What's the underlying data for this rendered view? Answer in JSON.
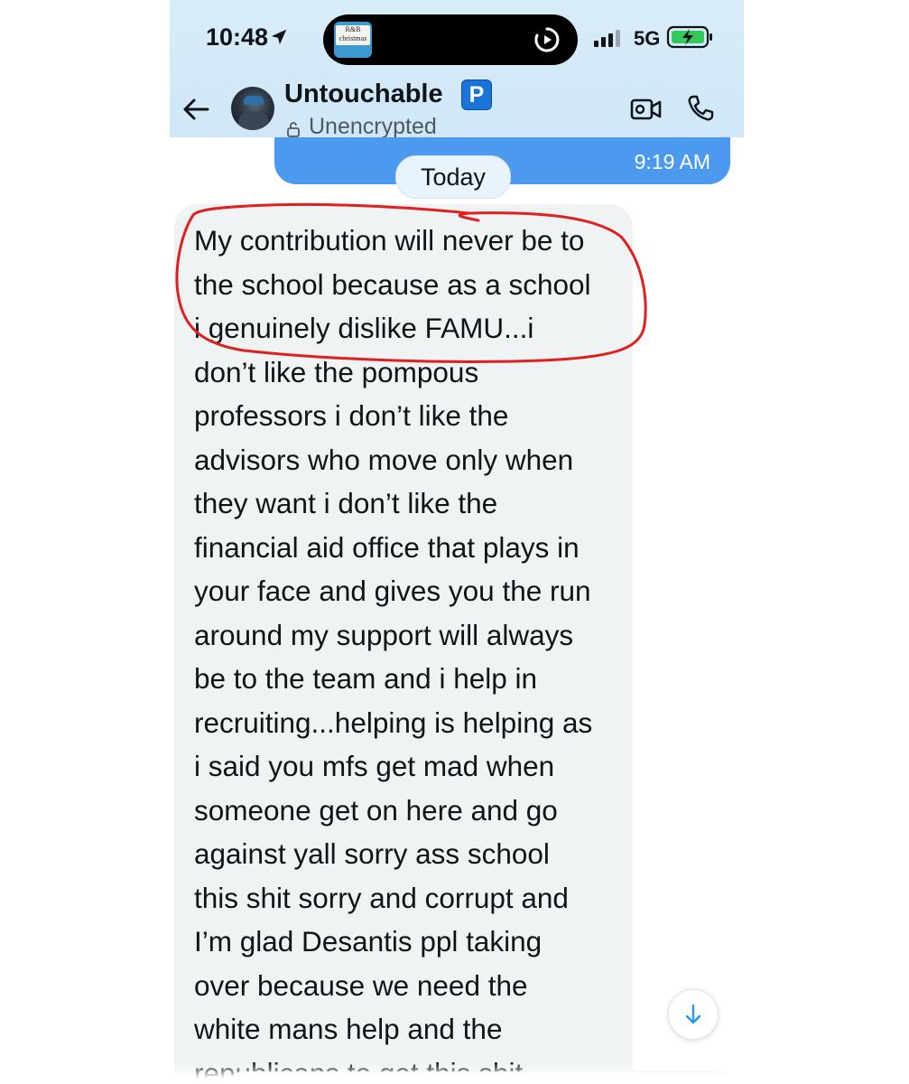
{
  "status_bar": {
    "time": "10:48",
    "network": "5G",
    "island_thumb_text": "R&B christmas"
  },
  "chat_header": {
    "contact_name": "Untouchable",
    "badge": "P",
    "encryption_status": "Unencrypted"
  },
  "prev_message": {
    "timestamp": "9:19 AM"
  },
  "date_separator": "Today",
  "message": {
    "text": "My contribution will never be to\nthe school because as a school\ni genuinely dislike FAMU...i\ndon’t like the pompous\nprofessors i don’t like the\nadvisors who move only when\nthey want i don’t like the\nfinancial aid office that plays in\nyour face and gives you the run\naround my support will always\nbe to the team and i help in\nrecruiting...helping is helping as\ni said you mfs get mad when\nsomeone get on here and go\nagainst yall sorry ass  school\nthis shit sorry and corrupt and\nI’m glad Desantis ppl taking\nover because we need the\nwhite mans help and the\nrepublicans to get this shit"
  },
  "colors": {
    "header_bg": "#d9ecf8",
    "sent_bubble": "#4c9af0",
    "received_bubble": "#eff3f4",
    "annotation": "#e02020",
    "badge": "#1a73d9"
  },
  "icons": {
    "location": "location-arrow-icon",
    "replay": "replay-icon",
    "signal": "signal-icon",
    "battery": "battery-charging-icon",
    "back": "back-arrow-icon",
    "lock": "lock-icon",
    "video": "video-call-icon",
    "phone": "phone-icon",
    "scroll": "arrow-down-icon"
  }
}
